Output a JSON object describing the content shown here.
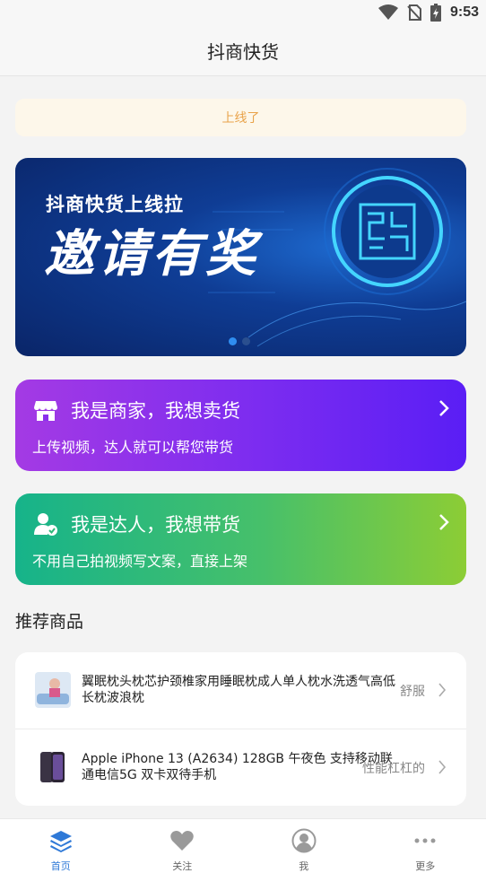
{
  "status": {
    "time": "9:53"
  },
  "header": {
    "title": "抖商快货"
  },
  "notice": {
    "text": "上线了"
  },
  "banner": {
    "subtitle": "抖商快货上线拉",
    "headline": "邀请有奖"
  },
  "cards": {
    "merchant": {
      "title": "我是商家，我想卖货",
      "desc": "上传视频，达人就可以帮您带货"
    },
    "talent": {
      "title": "我是达人，我想带货",
      "desc": "不用自己拍视频写文案，直接上架"
    }
  },
  "recommend": {
    "title": "推荐商品",
    "items": [
      {
        "name": "翼眠枕头枕芯护颈椎家用睡眠枕成人单人枕水洗透气高低长枕波浪枕",
        "tag": "舒服"
      },
      {
        "name": "Apple iPhone 13 (A2634) 128GB 午夜色 支持移动联通电信5G 双卡双待手机",
        "tag": "性能杠杠的"
      }
    ]
  },
  "tabs": [
    {
      "label": "首页",
      "icon": "layers-icon"
    },
    {
      "label": "关注",
      "icon": "heart-icon"
    },
    {
      "label": "我",
      "icon": "user-icon"
    },
    {
      "label": "更多",
      "icon": "more-icon"
    }
  ],
  "colors": {
    "accent": "#2f79d7",
    "notice_text": "#e9a34a",
    "merchant_card": "#7b2cf0",
    "talent_card": "#47c06a"
  }
}
